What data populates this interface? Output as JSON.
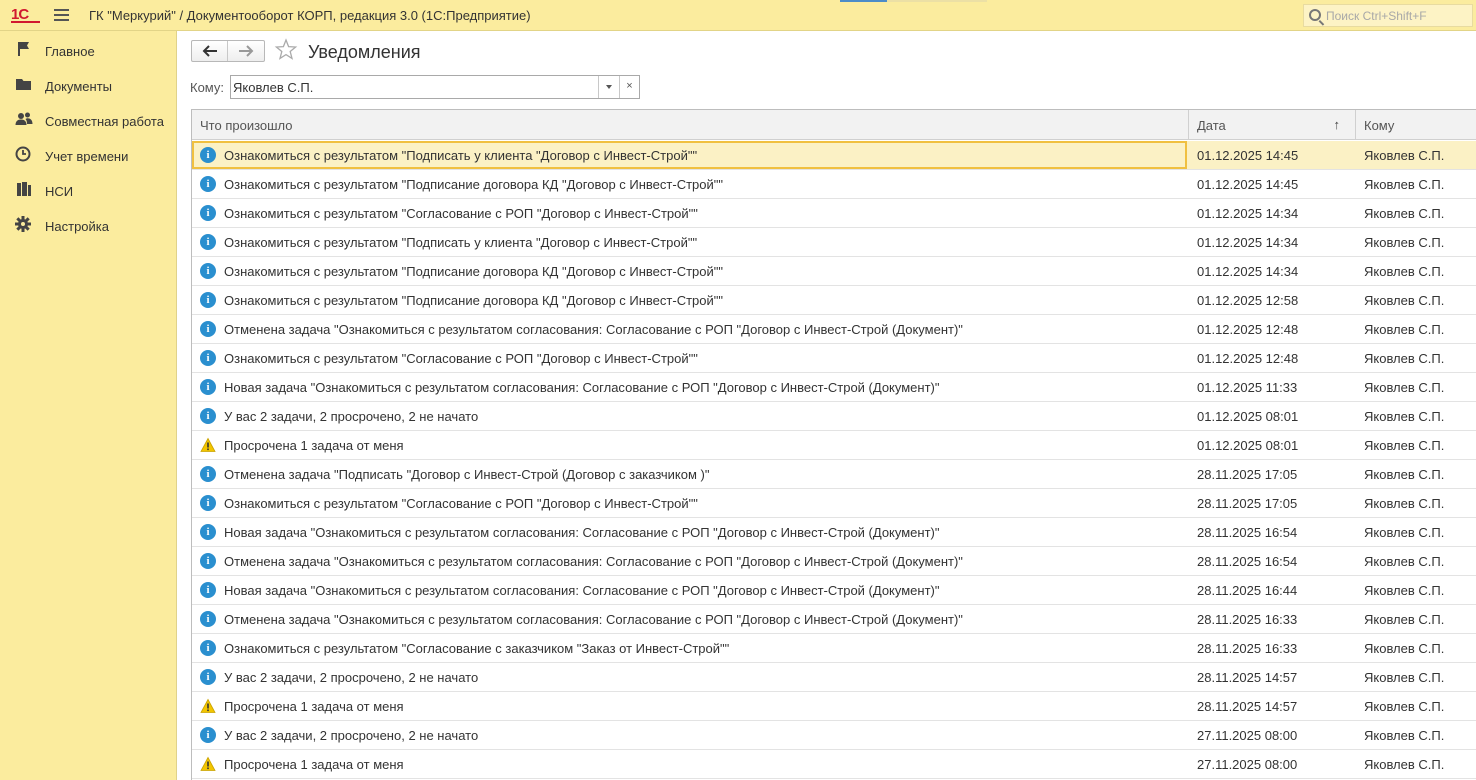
{
  "app": {
    "title": "ГК \"Меркурий\" / Документооборот КОРП, редакция 3.0  (1С:Предприятие)",
    "logo": "1С",
    "search_placeholder": "Поиск Ctrl+Shift+F"
  },
  "sidebar": {
    "items": [
      {
        "label": "Главное",
        "icon": "flag-icon"
      },
      {
        "label": "Документы",
        "icon": "folder-icon"
      },
      {
        "label": "Совместная работа",
        "icon": "people-icon"
      },
      {
        "label": "Учет времени",
        "icon": "clock-icon"
      },
      {
        "label": "НСИ",
        "icon": "books-icon"
      },
      {
        "label": "Настройка",
        "icon": "gear-icon"
      }
    ]
  },
  "page": {
    "title": "Уведомления",
    "filter_label": "Кому:",
    "filter_value": "Яковлев С.П.",
    "clear_glyph": "×"
  },
  "table": {
    "columns": [
      "Что произошло",
      "Дата",
      "Кому"
    ],
    "sort_glyph": "↑",
    "rows": [
      {
        "icon": "info",
        "text": "Ознакомиться с результатом \"Подписать у клиента  \"Договор с Инвест-Строй\"\"",
        "date": "01.12.2025 14:45",
        "to": "Яковлев С.П."
      },
      {
        "icon": "info",
        "text": "Ознакомиться с результатом \"Подписание договора КД  \"Договор с Инвест-Строй\"\"",
        "date": "01.12.2025 14:45",
        "to": "Яковлев С.П."
      },
      {
        "icon": "info",
        "text": "Ознакомиться с результатом \"Согласование с РОП  \"Договор с Инвест-Строй\"\"",
        "date": "01.12.2025 14:34",
        "to": "Яковлев С.П."
      },
      {
        "icon": "info",
        "text": "Ознакомиться с результатом \"Подписать у клиента  \"Договор с Инвест-Строй\"\"",
        "date": "01.12.2025 14:34",
        "to": "Яковлев С.П."
      },
      {
        "icon": "info",
        "text": "Ознакомиться с результатом \"Подписание договора КД  \"Договор с Инвест-Строй\"\"",
        "date": "01.12.2025 14:34",
        "to": "Яковлев С.П."
      },
      {
        "icon": "info",
        "text": "Ознакомиться с результатом \"Подписание договора КД  \"Договор с Инвест-Строй\"\"",
        "date": "01.12.2025 12:58",
        "to": "Яковлев С.П."
      },
      {
        "icon": "info",
        "text": "Отменена задача \"Ознакомиться с результатом согласования: Согласование с РОП \"Договор с Инвест-Строй (Документ)\"",
        "date": "01.12.2025 12:48",
        "to": "Яковлев С.П."
      },
      {
        "icon": "info",
        "text": "Ознакомиться с результатом \"Согласование с РОП  \"Договор с Инвест-Строй\"\"",
        "date": "01.12.2025 12:48",
        "to": "Яковлев С.П."
      },
      {
        "icon": "info",
        "text": "Новая задача \"Ознакомиться с результатом согласования: Согласование с РОП \"Договор с Инвест-Строй (Документ)\"",
        "date": "01.12.2025 11:33",
        "to": "Яковлев С.П."
      },
      {
        "icon": "info",
        "text": "У вас 2 задачи, 2 просрочено, 2 не начато",
        "date": "01.12.2025 08:01",
        "to": "Яковлев С.П."
      },
      {
        "icon": "warning",
        "text": "Просрочена 1 задача от меня",
        "date": "01.12.2025 08:01",
        "to": "Яковлев С.П."
      },
      {
        "icon": "info",
        "text": "Отменена задача \"Подписать \"Договор с Инвест-Строй (Договор с заказчиком )\"",
        "date": "28.11.2025 17:05",
        "to": "Яковлев С.П."
      },
      {
        "icon": "info",
        "text": "Ознакомиться с результатом \"Согласование с РОП  \"Договор с Инвест-Строй\"\"",
        "date": "28.11.2025 17:05",
        "to": "Яковлев С.П."
      },
      {
        "icon": "info",
        "text": "Новая задача \"Ознакомиться с результатом согласования: Согласование с РОП \"Договор с Инвест-Строй (Документ)\"",
        "date": "28.11.2025 16:54",
        "to": "Яковлев С.П."
      },
      {
        "icon": "info",
        "text": "Отменена задача \"Ознакомиться с результатом согласования: Согласование с РОП \"Договор с Инвест-Строй (Документ)\"",
        "date": "28.11.2025 16:54",
        "to": "Яковлев С.П."
      },
      {
        "icon": "info",
        "text": "Новая задача \"Ознакомиться с результатом согласования: Согласование с РОП \"Договор с Инвест-Строй (Документ)\"",
        "date": "28.11.2025 16:44",
        "to": "Яковлев С.П."
      },
      {
        "icon": "info",
        "text": "Отменена задача \"Ознакомиться с результатом согласования: Согласование с РОП \"Договор с Инвест-Строй (Документ)\"",
        "date": "28.11.2025 16:33",
        "to": "Яковлев С.П."
      },
      {
        "icon": "info",
        "text": "Ознакомиться с результатом \"Согласование с заказчиком  \"Заказ от Инвест-Строй\"\"",
        "date": "28.11.2025 16:33",
        "to": "Яковлев С.П."
      },
      {
        "icon": "info",
        "text": "У вас 2 задачи, 2 просрочено, 2 не начато",
        "date": "28.11.2025 14:57",
        "to": "Яковлев С.П."
      },
      {
        "icon": "warning",
        "text": "Просрочена 1 задача от меня",
        "date": "28.11.2025 14:57",
        "to": "Яковлев С.П."
      },
      {
        "icon": "info",
        "text": "У вас 2 задачи, 2 просрочено, 2 не начато",
        "date": "27.11.2025 08:00",
        "to": "Яковлев С.П."
      },
      {
        "icon": "warning",
        "text": "Просрочена 1 задача от меня",
        "date": "27.11.2025 08:00",
        "to": "Яковлев С.П."
      }
    ]
  },
  "colors": {
    "panel_bg": "#fbec9e",
    "selected_row": "#fbf1c5",
    "selection_border": "#f0c040",
    "info_icon": "#2a8fcf",
    "warning_icon": "#f2c500",
    "logo_red": "#d1192f"
  }
}
